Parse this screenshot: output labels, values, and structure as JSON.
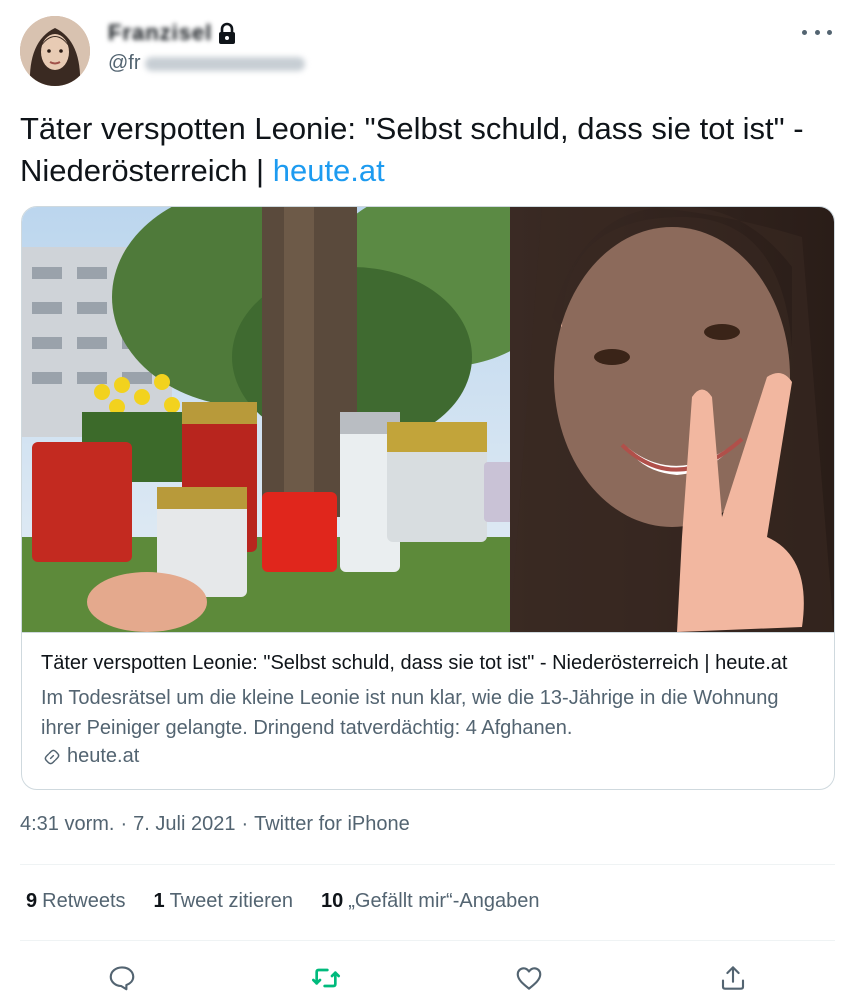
{
  "user": {
    "display_name": "Franzisel",
    "handle_prefix": "@fr"
  },
  "tweet": {
    "text": "Täter verspotten Leonie: \"Selbst schuld, dass sie tot ist\" - Niederösterreich | ",
    "link": "heute.at"
  },
  "card": {
    "title": "Täter verspotten Leonie: \"Selbst schuld, dass sie tot ist\" - Niederösterreich | heute.at",
    "description": "Im Todesrätsel um die kleine Leonie ist nun klar, wie die 13-Jährige in die Wohnung ihrer Peiniger gelangte. Dringend tatverdächtig: 4 Afghanen.",
    "domain": "heute.at"
  },
  "meta": {
    "time": "4:31 vorm.",
    "sep1": "·",
    "date": "7. Juli 2021",
    "sep2": "·",
    "source": "Twitter for iPhone"
  },
  "stats": {
    "retweets_count": "9",
    "retweets_label": "Retweets",
    "quotes_count": "1",
    "quotes_label": "Tweet zitieren",
    "likes_count": "10",
    "likes_label": "„Gefällt mir“-Angaben"
  },
  "icons": {
    "reply": "speech-bubble-icon",
    "retweet": "retweet-icon",
    "like": "heart-icon",
    "share": "share-icon",
    "lock": "lock-icon",
    "link": "link-icon",
    "more": "ellipsis-icon"
  },
  "colors": {
    "link": "#1d9bf0",
    "secondary_text": "#536471",
    "retweet_active": "#00ba7c"
  }
}
